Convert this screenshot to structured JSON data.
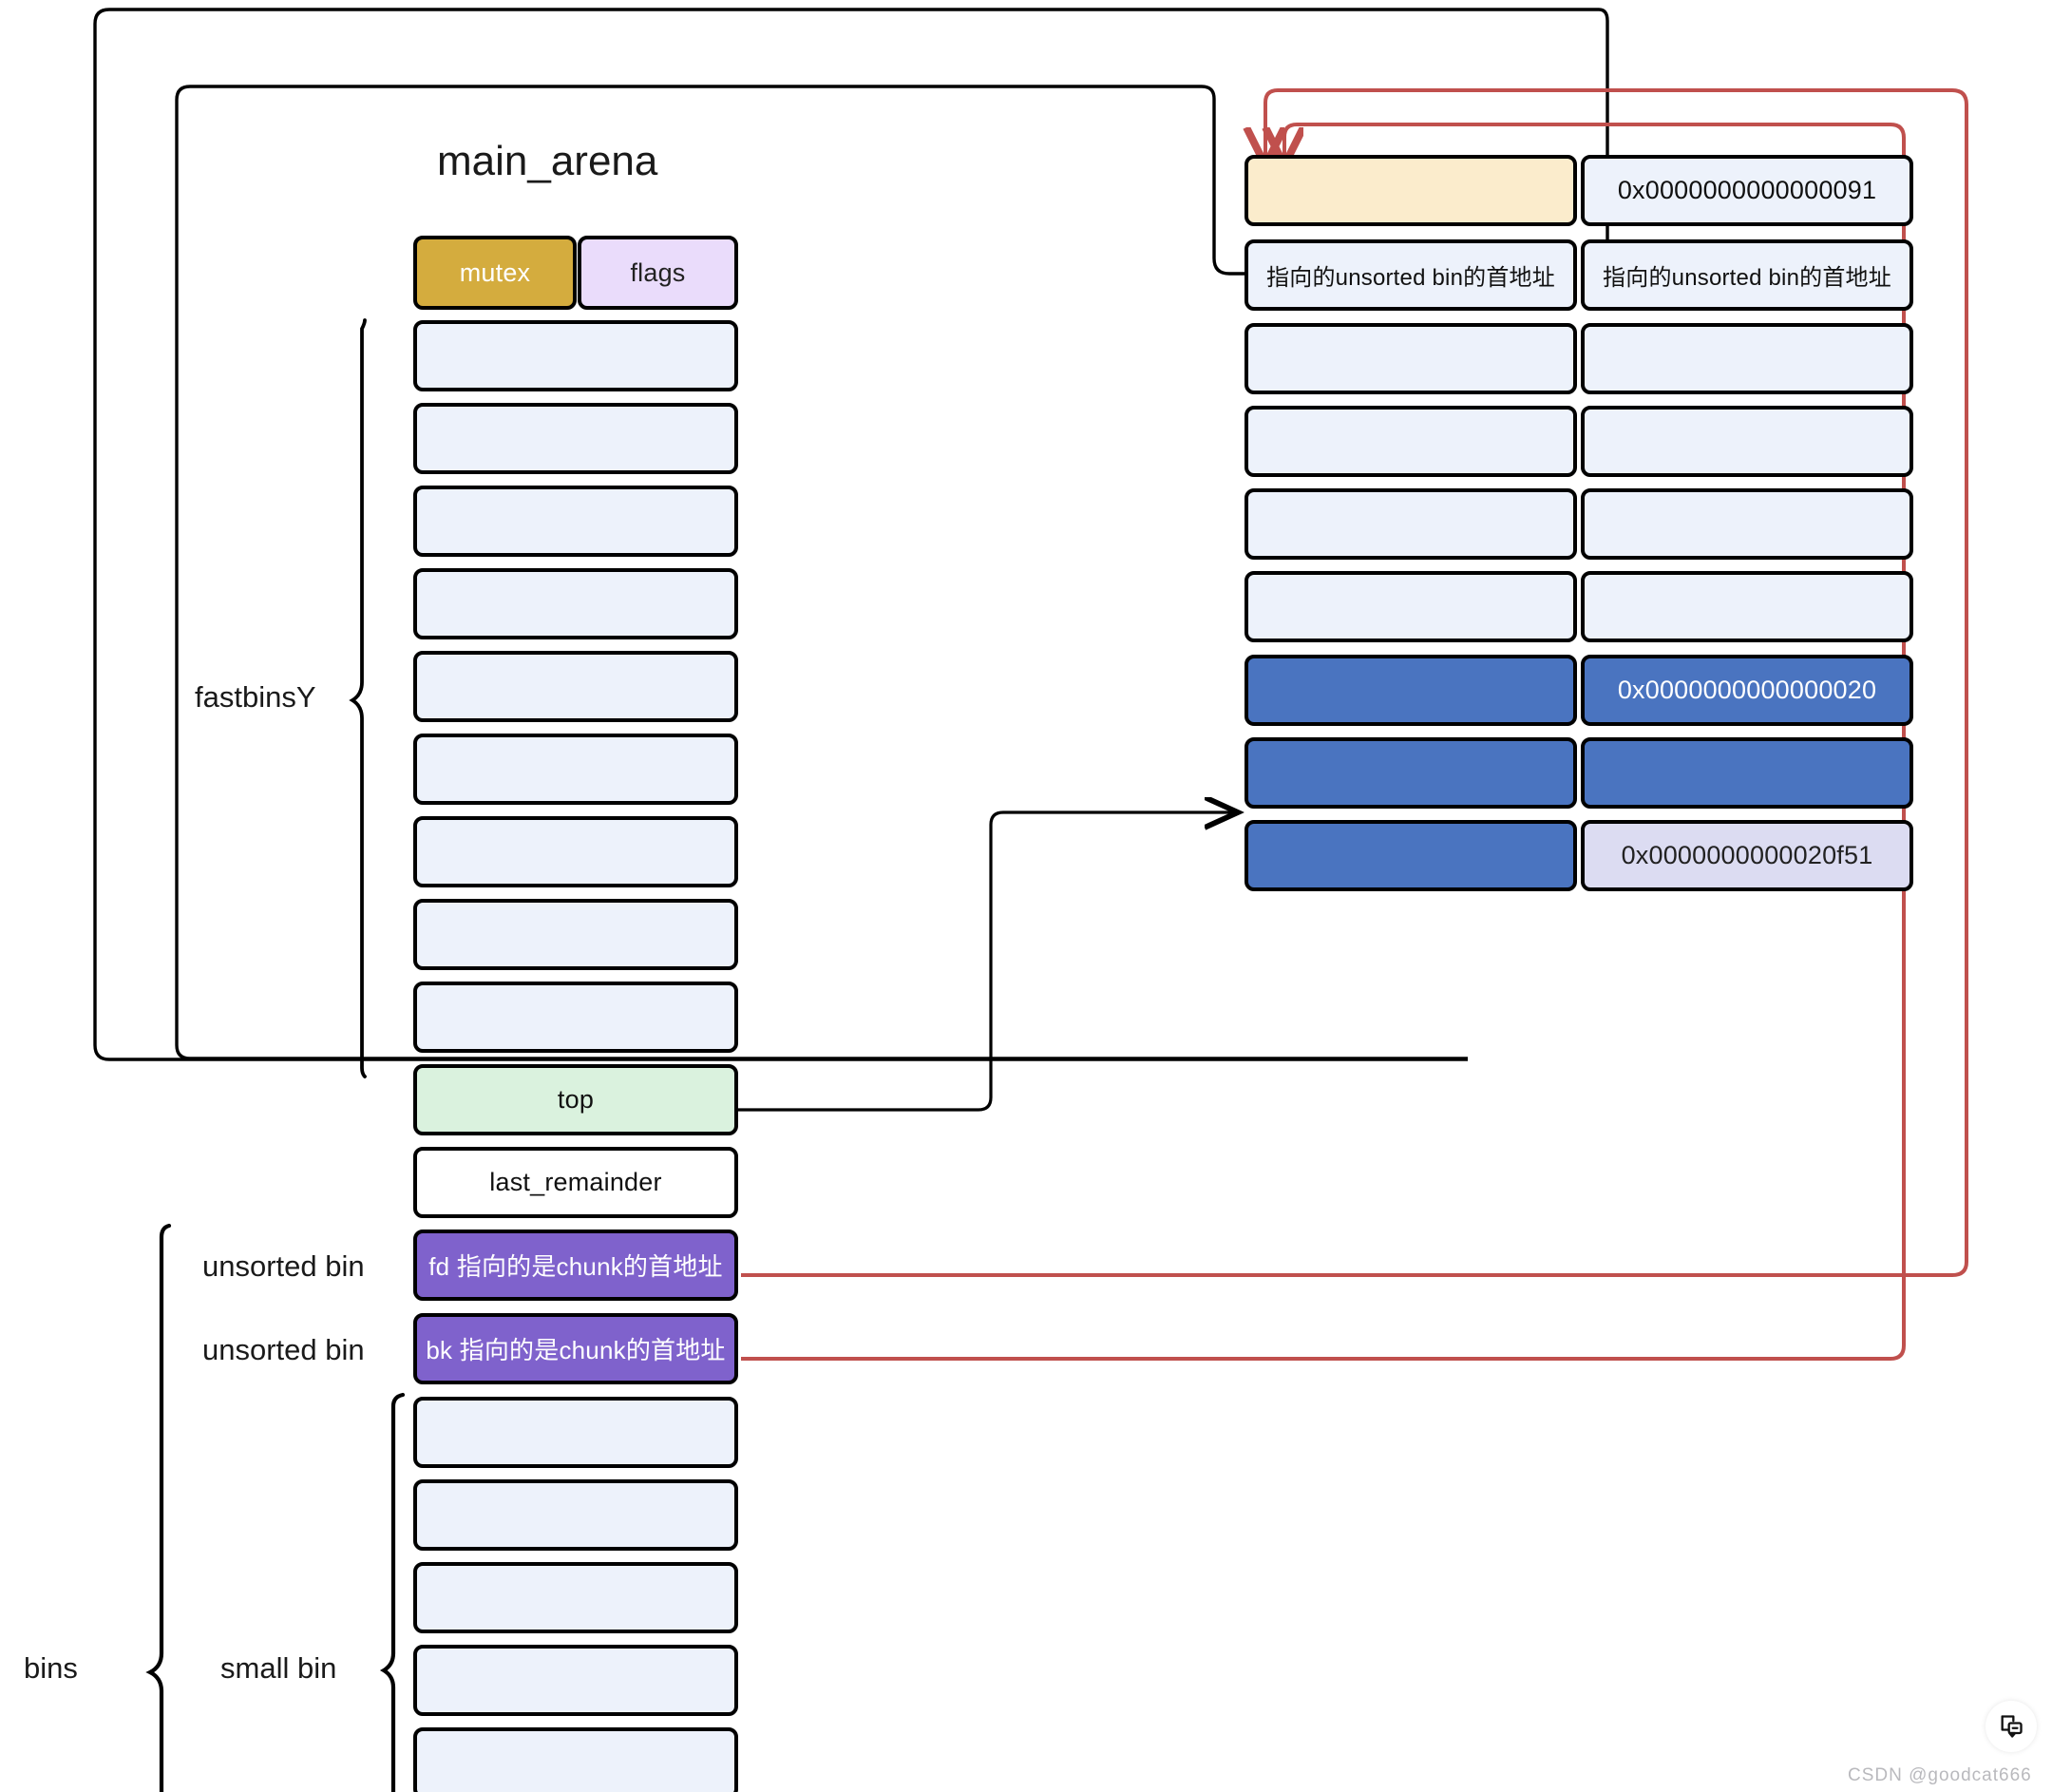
{
  "diagram": {
    "title": "main_arena",
    "watermark": "CSDN @goodcat666",
    "colors": {
      "mutex": "#d4ac3e",
      "flags": "#eadcfb",
      "empty_slot": "#edf2fb",
      "top": "#daf2de",
      "fd_bk": "#7f62cc",
      "chunk_header": "#fbeccc",
      "chunk_blue": "#4a74c0",
      "chunk_lavender": "#dcdcf2",
      "arrow_black": "#000000",
      "arrow_red": "#c0504d"
    },
    "braces": {
      "fastbinsY": "fastbinsY",
      "bins": "bins",
      "small_bin": "small bin"
    },
    "row_labels": {
      "unsorted_bin_fd": "unsorted bin",
      "unsorted_bin_bk": "unsorted bin"
    },
    "arena_rows": [
      {
        "name": "mutex",
        "label": "mutex",
        "style": "mutex"
      },
      {
        "name": "flags",
        "label": "flags",
        "style": "flags"
      },
      {
        "name": "fastbin-slot-1",
        "label": "",
        "style": "empty"
      },
      {
        "name": "fastbin-slot-2",
        "label": "",
        "style": "empty"
      },
      {
        "name": "fastbin-slot-3",
        "label": "",
        "style": "empty"
      },
      {
        "name": "fastbin-slot-4",
        "label": "",
        "style": "empty"
      },
      {
        "name": "fastbin-slot-5",
        "label": "",
        "style": "empty"
      },
      {
        "name": "fastbin-slot-6",
        "label": "",
        "style": "empty"
      },
      {
        "name": "fastbin-slot-7",
        "label": "",
        "style": "empty"
      },
      {
        "name": "fastbin-slot-8",
        "label": "",
        "style": "empty"
      },
      {
        "name": "fastbin-slot-9",
        "label": "",
        "style": "empty"
      },
      {
        "name": "top",
        "label": "top",
        "style": "top"
      },
      {
        "name": "last_remainder",
        "label": "last_remainder",
        "style": "plain"
      },
      {
        "name": "fd",
        "label": "fd 指向的是chunk的首地址",
        "style": "fdbk"
      },
      {
        "name": "bk",
        "label": "bk 指向的是chunk的首地址",
        "style": "fdbk"
      },
      {
        "name": "smallbin-slot-1",
        "label": "",
        "style": "empty"
      },
      {
        "name": "smallbin-slot-2",
        "label": "",
        "style": "empty"
      },
      {
        "name": "smallbin-slot-3",
        "label": "",
        "style": "empty"
      },
      {
        "name": "smallbin-slot-4",
        "label": "",
        "style": "empty"
      },
      {
        "name": "smallbin-slot-5",
        "label": "",
        "style": "empty"
      }
    ],
    "chunk_rows": [
      {
        "left": "",
        "left_style": "cream",
        "right": "0x0000000000000091",
        "right_style": "empty"
      },
      {
        "left": "指向的unsorted bin的首地址",
        "left_style": "empty",
        "right": "指向的unsorted bin的首地址",
        "right_style": "empty"
      },
      {
        "left": "",
        "left_style": "empty",
        "right": "",
        "right_style": "empty"
      },
      {
        "left": "",
        "left_style": "empty",
        "right": "",
        "right_style": "empty"
      },
      {
        "left": "",
        "left_style": "empty",
        "right": "",
        "right_style": "empty"
      },
      {
        "left": "",
        "left_style": "empty",
        "right": "",
        "right_style": "empty"
      },
      {
        "left": "",
        "left_style": "blue",
        "right": "0x0000000000000020",
        "right_style": "blue"
      },
      {
        "left": "",
        "left_style": "blue",
        "right": "",
        "right_style": "blue"
      },
      {
        "left": "",
        "left_style": "blue",
        "right": "0x0000000000020f51",
        "right_style": "lav"
      }
    ]
  }
}
